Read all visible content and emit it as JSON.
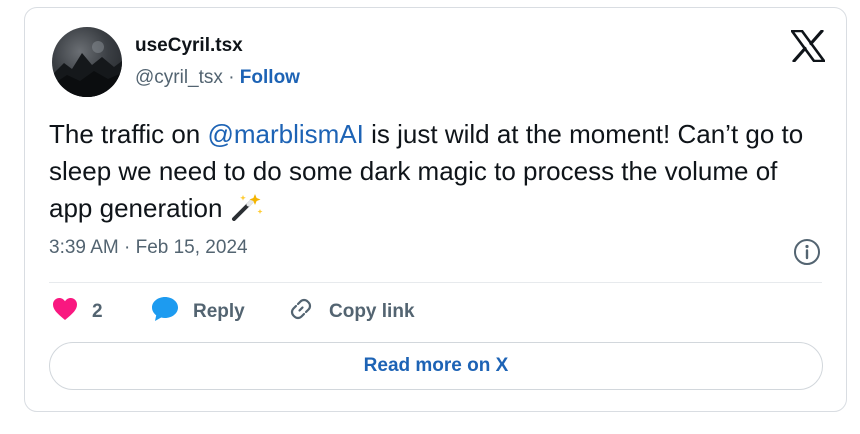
{
  "author": {
    "display_name": "useCyril.tsx",
    "handle": "@cyril_tsx",
    "separator": "·",
    "follow_label": "Follow"
  },
  "tweet": {
    "text_before": "The traffic on ",
    "mention": "@marblismAI",
    "text_after": " is just wild at the moment! Can’t go to sleep we need to do some dark magic to process the volume of app generation",
    "emoji": "magic-wand-emoji",
    "timestamp": "3:39 AM · Feb 15, 2024"
  },
  "actions": {
    "like_count": "2",
    "reply_label": "Reply",
    "copy_link_label": "Copy link"
  },
  "read_more_label": "Read more on X",
  "icons": {
    "brand": "x-logo-icon",
    "info": "info-icon",
    "like": "heart-icon",
    "reply": "speech-bubble-icon",
    "copy": "link-icon"
  },
  "colors": {
    "link": "#1d63b5",
    "like": "#f91880",
    "reply": "#1d9bf0",
    "muted": "#536471",
    "text": "#0f1419"
  }
}
